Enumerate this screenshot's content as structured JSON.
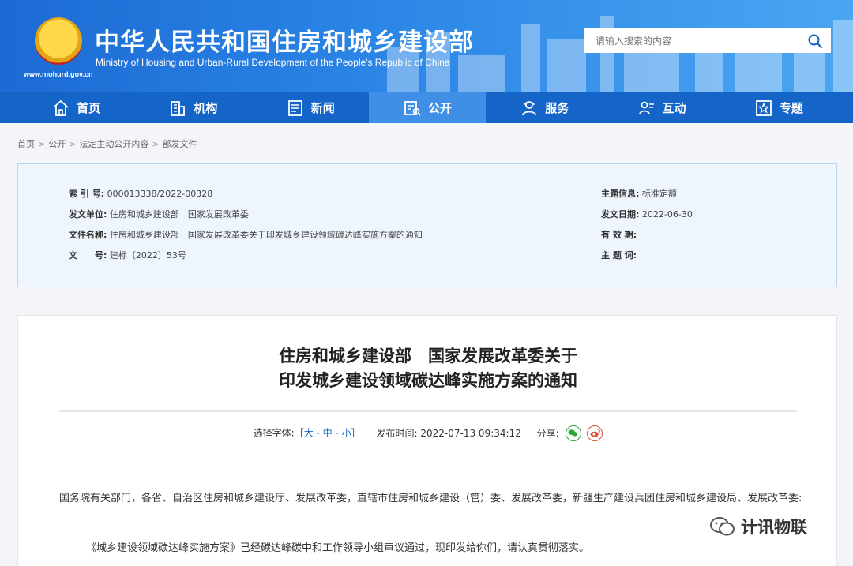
{
  "header": {
    "title": "中华人民共和国住房和城乡建设部",
    "subtitle": "Ministry of Housing and Urban-Rural Development of the People's Republic of China",
    "url": "www.mohurd.gov.cn",
    "search_placeholder": "请输入搜索的内容",
    "brand_color": "#1c6ad4"
  },
  "nav": {
    "items": [
      {
        "label": "首页",
        "icon": "home-icon"
      },
      {
        "label": "机构",
        "icon": "building-icon"
      },
      {
        "label": "新闻",
        "icon": "news-icon"
      },
      {
        "label": "公开",
        "icon": "public-doc-icon",
        "active": true
      },
      {
        "label": "服务",
        "icon": "service-icon"
      },
      {
        "label": "互动",
        "icon": "interaction-icon"
      },
      {
        "label": "专题",
        "icon": "star-icon"
      }
    ]
  },
  "breadcrumb": [
    "首页",
    "公开",
    "法定主动公开内容",
    "部发文件"
  ],
  "info": {
    "index_label": "索 引 号:",
    "index_value": "000013338/2022-00328",
    "issuer_label": "发文单位:",
    "issuer_value": "住房和城乡建设部　国家发展改革委",
    "filename_label": "文件名称:",
    "filename_value": "住房和城乡建设部　国家发展改革委关于印发城乡建设领域碳达峰实施方案的通知",
    "docno_label": "文　　号:",
    "docno_value": "建标〔2022〕53号",
    "topic_label": "主题信息:",
    "topic_value": "标准定额",
    "date_label": "发文日期:",
    "date_value": "2022-06-30",
    "validity_label": "有 效 期:",
    "validity_value": "",
    "keywords_label": "主 题 词:",
    "keywords_value": ""
  },
  "article": {
    "title_line1": "住房和城乡建设部　国家发展改革委关于",
    "title_line2": "印发城乡建设领域碳达峰实施方案的通知",
    "font_label": "选择字体:",
    "font_large": "大",
    "font_medium": "中",
    "font_small": "小",
    "publish_label": "发布时间:",
    "publish_time": "2022-07-13 09:34:12",
    "share_label": "分享:",
    "para1": "国务院有关部门，各省、自治区住房和城乡建设厅、发展改革委，直辖市住房和城乡建设（管）委、发展改革委，新疆生产建设兵团住房和城乡建设局、发展改革委:",
    "para2": "《城乡建设领域碳达峰实施方案》已经碳达峰碳中和工作领导小组审议通过，现印发给你们，请认真贯彻落实。"
  },
  "watermark": {
    "text": "计讯物联"
  }
}
